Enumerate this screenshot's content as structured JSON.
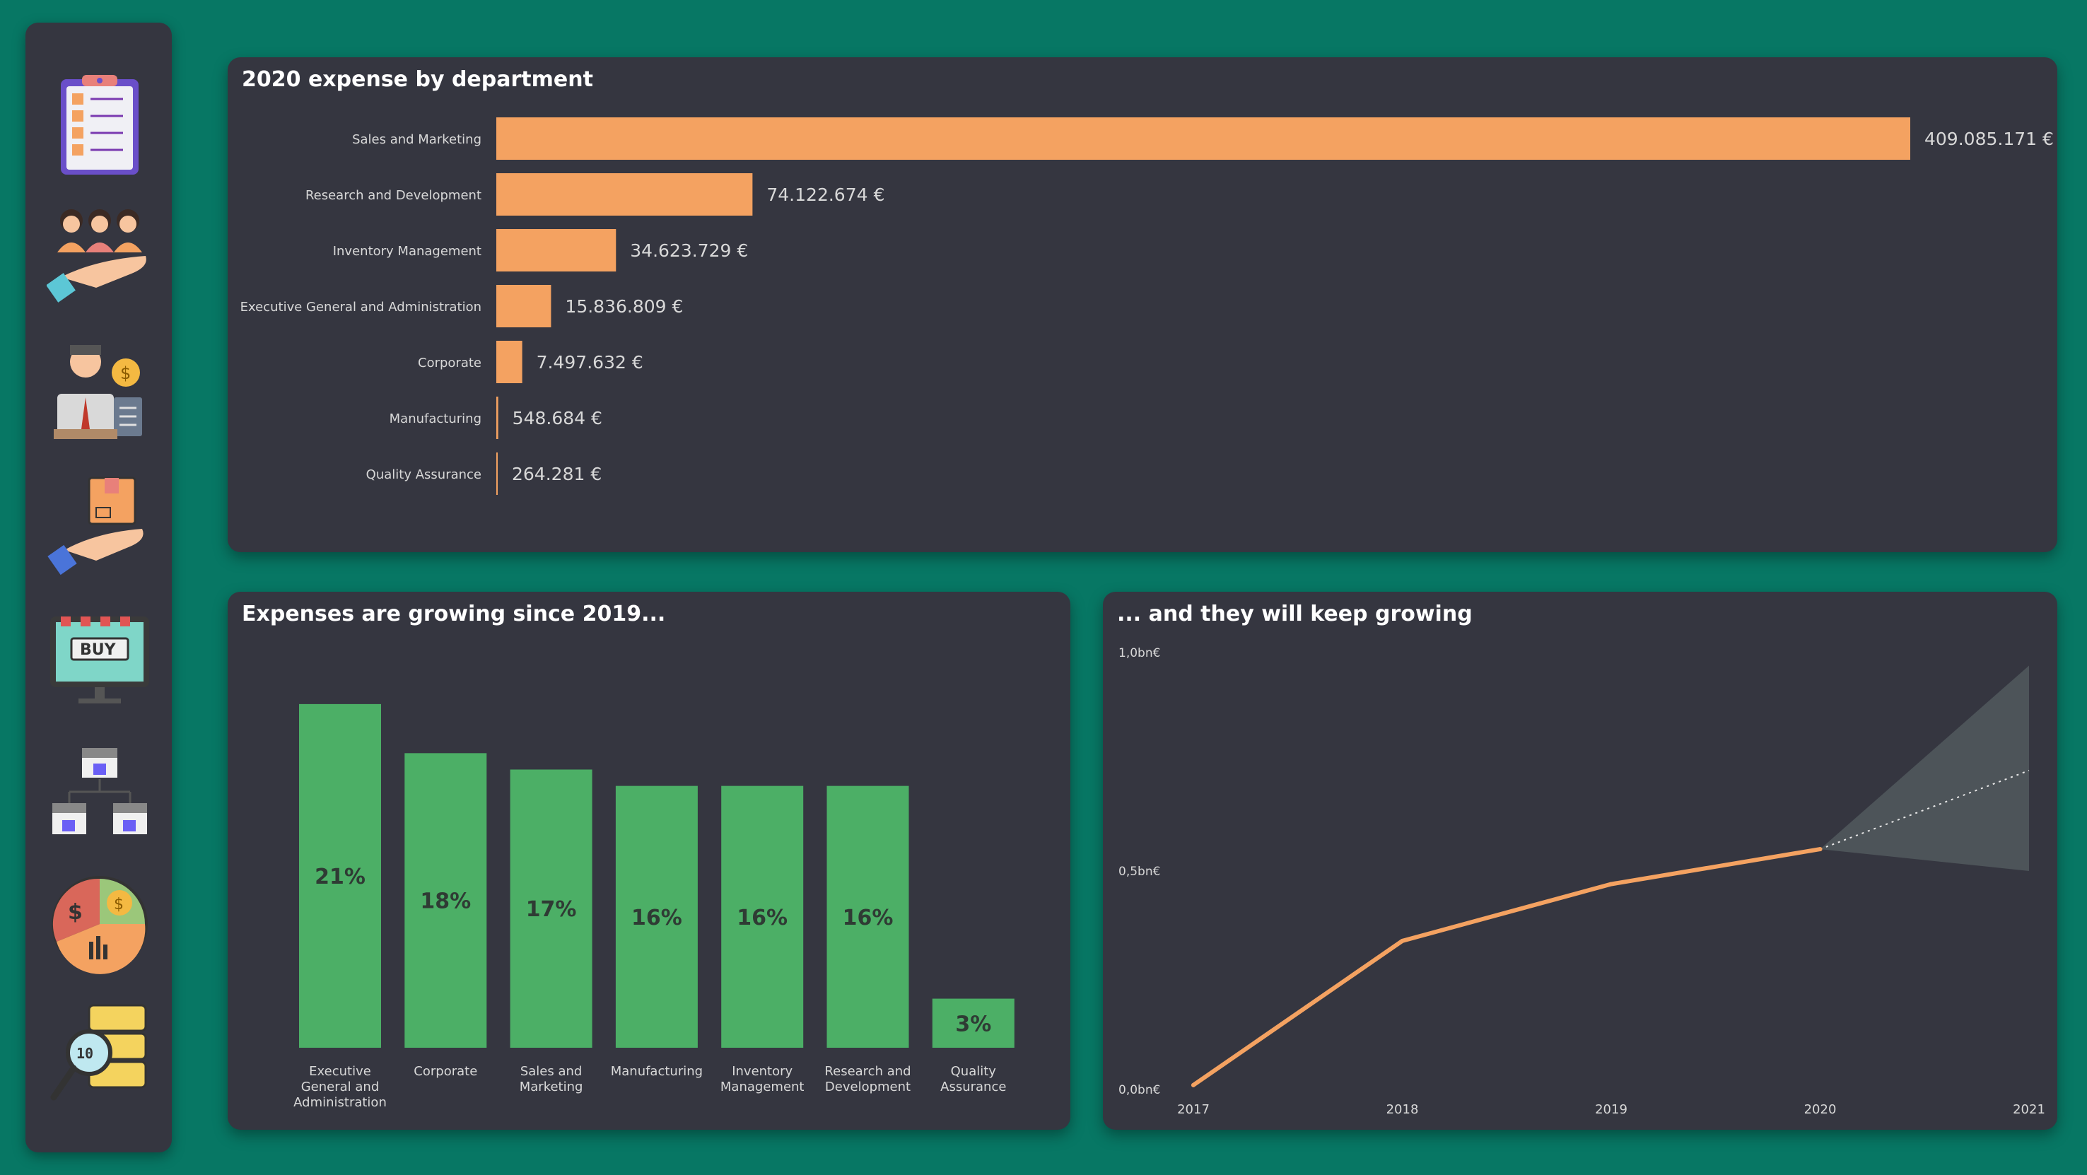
{
  "navigation": [
    {
      "icon": "clipboard-checklist-icon"
    },
    {
      "icon": "team-in-hand-icon"
    },
    {
      "icon": "accountant-icon"
    },
    {
      "icon": "package-in-hand-icon"
    },
    {
      "icon": "online-shop-buy-icon"
    },
    {
      "icon": "store-network-icon"
    },
    {
      "icon": "pie-chart-money-icon"
    },
    {
      "icon": "data-search-icon"
    }
  ],
  "colors": {
    "background": "#077764",
    "panel": "#353640",
    "bar_orange": "#f4a261",
    "bar_green": "#4caf66",
    "forecast_band": "#4d5459",
    "label_text": "#d8d8d8"
  },
  "chart_data": [
    {
      "type": "bar",
      "orientation": "horizontal",
      "title": "2020 expense by department",
      "categories": [
        "Sales and Marketing",
        "Research and Development",
        "Inventory Management",
        "Executive General and Administration",
        "Corporate",
        "Manufacturing",
        "Quality Assurance"
      ],
      "values": [
        409085171,
        74122674,
        34623729,
        15836809,
        7497632,
        548684,
        264281
      ],
      "data_labels": [
        "409.085.171 €",
        "74.122.674 €",
        "34.623.729 €",
        "15.836.809 €",
        "7.497.632 €",
        "548.684 €",
        "264.281 €"
      ],
      "color": "#f4a261",
      "grid": false,
      "legend": "none"
    },
    {
      "type": "bar",
      "orientation": "vertical",
      "title": "Expenses are growing since 2019...",
      "categories": [
        [
          "Executive",
          "General and",
          "Administration"
        ],
        [
          "Corporate"
        ],
        [
          "Sales and",
          "Marketing"
        ],
        [
          "Manufacturing"
        ],
        [
          "Inventory",
          "Management"
        ],
        [
          "Research and",
          "Development"
        ],
        [
          "Quality",
          "Assurance"
        ]
      ],
      "values": [
        21,
        18,
        17,
        16,
        16,
        16,
        3
      ],
      "data_labels": [
        "21%",
        "18%",
        "17%",
        "16%",
        "16%",
        "16%",
        "3%"
      ],
      "unit": "%",
      "color": "#4caf66",
      "ylim": [
        0,
        21.6
      ],
      "grid": false,
      "legend": "none"
    },
    {
      "type": "line",
      "title": "... and they will keep growing",
      "x": [
        2017,
        2018,
        2019,
        2020
      ],
      "y": [
        0.01,
        0.34,
        0.47,
        0.55
      ],
      "forecast": {
        "x": [
          2020,
          2021
        ],
        "y": [
          0.55,
          0.73
        ],
        "upper": [
          0.55,
          0.97
        ],
        "lower": [
          0.55,
          0.5
        ]
      },
      "x_ticks": [
        "2017",
        "2018",
        "2019",
        "2020",
        "2021"
      ],
      "y_ticks": [
        {
          "value": 0,
          "label": "0,0bn€"
        },
        {
          "value": 0.5,
          "label": "0,5bn€"
        },
        {
          "value": 1,
          "label": "1,0bn€"
        }
      ],
      "xlim": [
        2017,
        2021
      ],
      "ylim": [
        0,
        1
      ],
      "color": "#f4a261",
      "grid": false,
      "legend": "none"
    }
  ]
}
